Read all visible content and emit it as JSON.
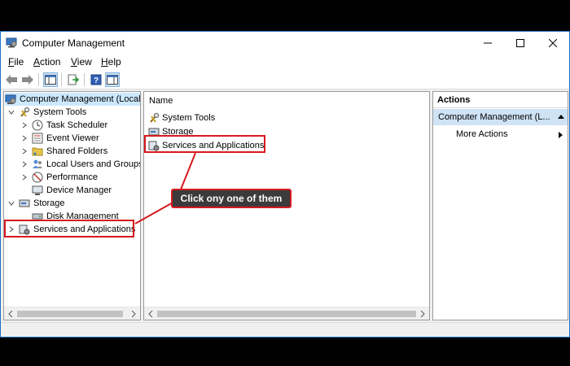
{
  "window": {
    "title": "Computer Management"
  },
  "menu": [
    "File",
    "Action",
    "View",
    "Help"
  ],
  "tree": {
    "root": "Computer Management (Local",
    "system_tools": "System Tools",
    "items": [
      "Task Scheduler",
      "Event Viewer",
      "Shared Folders",
      "Local Users and Groups",
      "Performance",
      "Device Manager"
    ],
    "storage": "Storage",
    "disk_management": "Disk Management",
    "services": "Services and Applications"
  },
  "list": {
    "header": "Name",
    "rows": [
      "System Tools",
      "Storage",
      "Services and Applications"
    ]
  },
  "actions": {
    "header": "Actions",
    "section": "Computer Management (L...",
    "more": "More Actions"
  },
  "annotation": {
    "callout": "Click ony one of them"
  },
  "colors": {
    "highlight": "#d7191f",
    "selection": "#cce8ff",
    "title_border": "#1a73c8"
  }
}
